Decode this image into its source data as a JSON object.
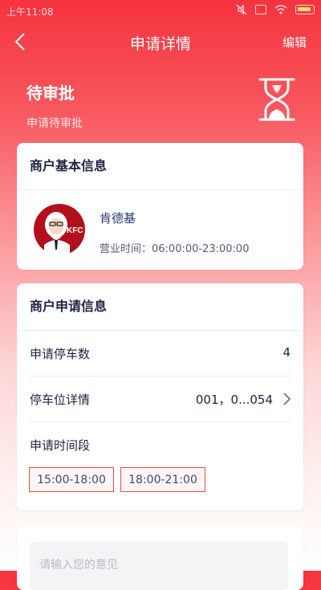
{
  "status_bar": {
    "time": "上午11:08",
    "icons": [
      "mute-icon",
      "sim-x-icon",
      "wifi-icon",
      "battery-charging-icon"
    ]
  },
  "nav": {
    "title": "申请详情",
    "edit_label": "编辑"
  },
  "status": {
    "title": "待审批",
    "subtitle": "申请待审批",
    "icon": "hourglass-icon"
  },
  "merchant_card": {
    "title": "商户基本信息",
    "name": "肯德基",
    "hours": "营业时间：06:00:00-23:00:00",
    "logo_text": "KFC"
  },
  "application_card": {
    "title": "商户申请信息",
    "parking_count_label": "申请停车数",
    "parking_count": "4",
    "parking_detail_label": "停车位详情",
    "parking_detail_value": "001，0...054",
    "time_slot_label": "申请时间段",
    "time_slots": [
      "15:00-18:00",
      "18:00-21:00"
    ]
  },
  "opinion_card": {
    "placeholder": "请输入您的意见"
  },
  "colors": {
    "brand_red": "#f5333f",
    "slot_border": "#f04a4a",
    "title_navy": "#1d2340"
  }
}
